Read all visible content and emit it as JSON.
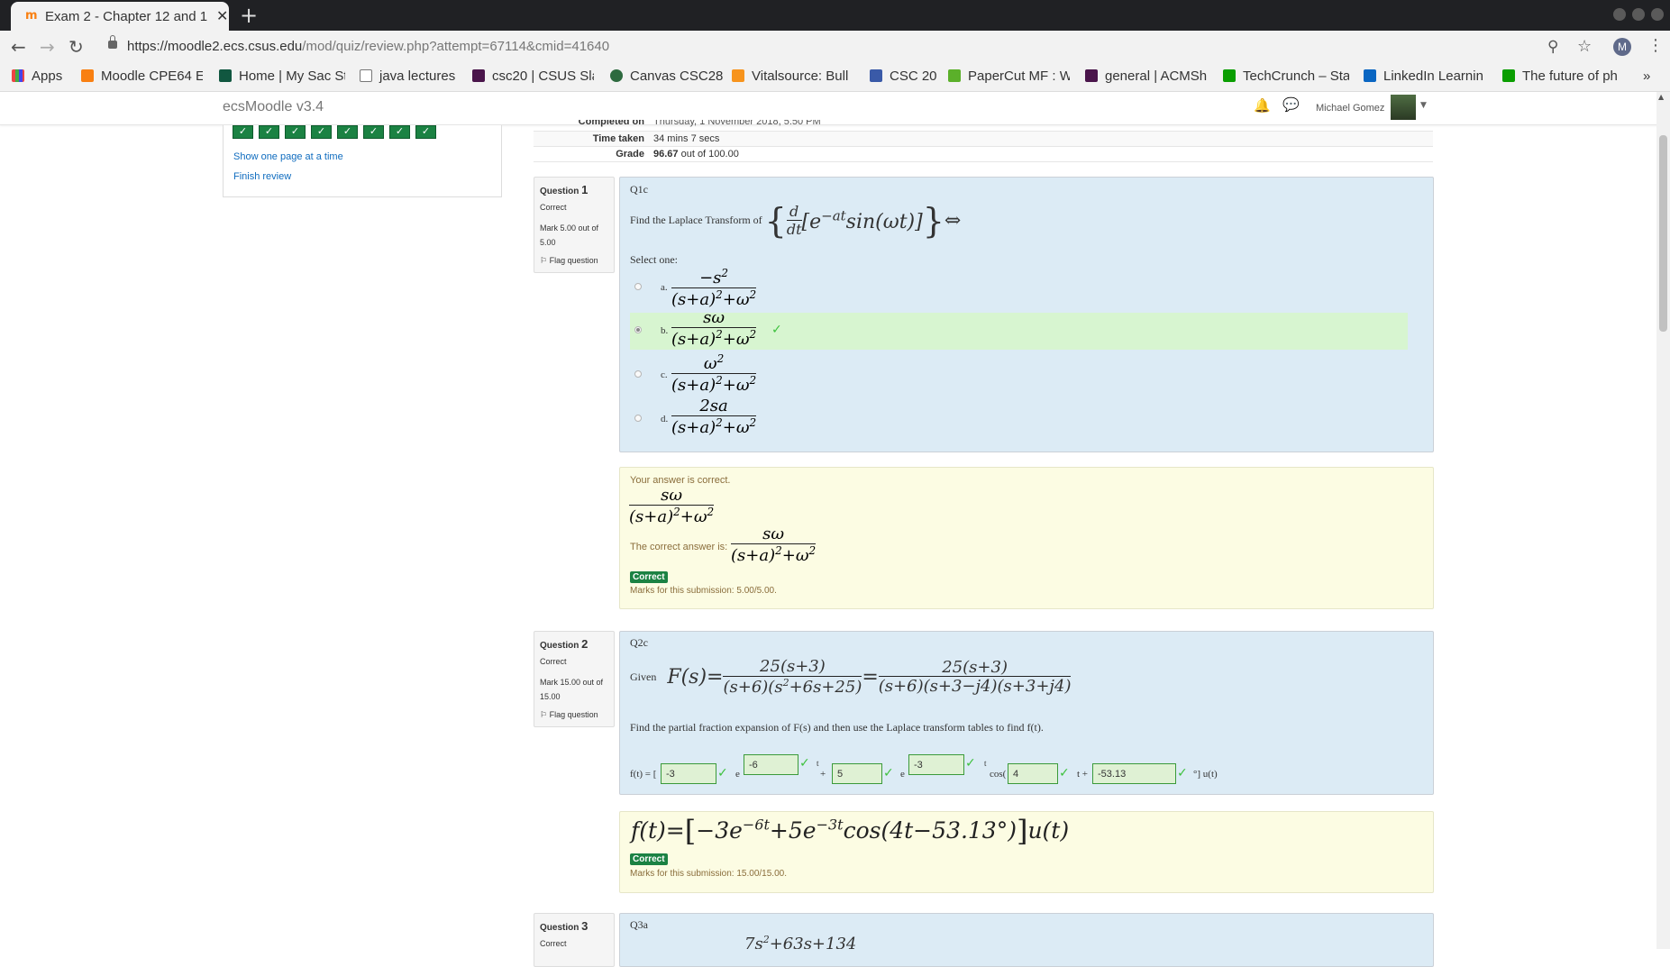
{
  "browser": {
    "tab_title": "Exam 2 - Chapter 12 and 1",
    "url_host": "https://moodle2.ecs.csus.edu",
    "url_path": "/mod/quiz/review.php?attempt=67114&cmid=41640",
    "profile_initial": "M",
    "bookmarks": [
      "Apps",
      "Moodle CPE64 E",
      "Home | My Sac St",
      "java lectures",
      "csc20 | CSUS Slac",
      "Canvas CSC28",
      "Vitalsource: Bull",
      "CSC 20",
      "PaperCut MF : W",
      "general | ACMSh",
      "TechCrunch – Sta",
      "LinkedIn Learnin",
      "The future of ph"
    ],
    "bookmarks_more": "»"
  },
  "moodle": {
    "brand": "ecsMoodle v3.4",
    "user_name": "Michael Gomez"
  },
  "quiz_nav": {
    "show_one_page": "Show one page at a time",
    "finish_review": "Finish review",
    "buttons_check": "✓"
  },
  "summary": {
    "completed_label": "Completed on",
    "completed_value": "Thursday, 1 November 2018, 5:50 PM",
    "time_label": "Time taken",
    "time_value": "34 mins 7 secs",
    "grade_label": "Grade",
    "grade_value": "96.67",
    "grade_rest": "out of 100.00"
  },
  "q1": {
    "word": "Question",
    "num": "1",
    "state": "Correct",
    "mark": "Mark 5.00 out of 5.00",
    "flag": "Flag question",
    "name": "Q1c",
    "prompt": "Find the Laplace Transform of",
    "select_one": "Select one:",
    "opt_a": "a.",
    "opt_b": "b.",
    "opt_c": "c.",
    "opt_d": "d.",
    "fb_correct": "Your answer is correct.",
    "fb_right": "The correct answer is:",
    "badge": "Correct",
    "marks_sub": "Marks for this submission: 5.00/5.00."
  },
  "q2": {
    "word": "Question",
    "num": "2",
    "state": "Correct",
    "mark": "Mark 15.00 out of 15.00",
    "flag": "Flag question",
    "name": "Q2c",
    "given": "Given",
    "instruction": "Find the partial fraction expansion of F(s) and then use the Laplace transform tables to find f(t).",
    "ft_label": "f(t) = [",
    "e1": "e",
    "t1": "t",
    "plus1": "+",
    "e2": "e",
    "t2": "t",
    "cos": "cos(",
    "tplus": "t +",
    "tail": "°] u(t)",
    "inputs": {
      "a": "-3",
      "b": "-6",
      "c": "5",
      "d": "-3",
      "e": "4",
      "f": "-53.13"
    },
    "badge": "Correct",
    "marks_sub": "Marks for this submission: 15.00/15.00."
  },
  "q3": {
    "word": "Question",
    "num": "3",
    "state": "Correct",
    "name": "Q3a"
  },
  "colors": {
    "correct_green": "#1b8243",
    "question_bg": "#dcebf5",
    "feedback_bg": "#fcfce3",
    "selected_bg": "#d7f5d0"
  }
}
